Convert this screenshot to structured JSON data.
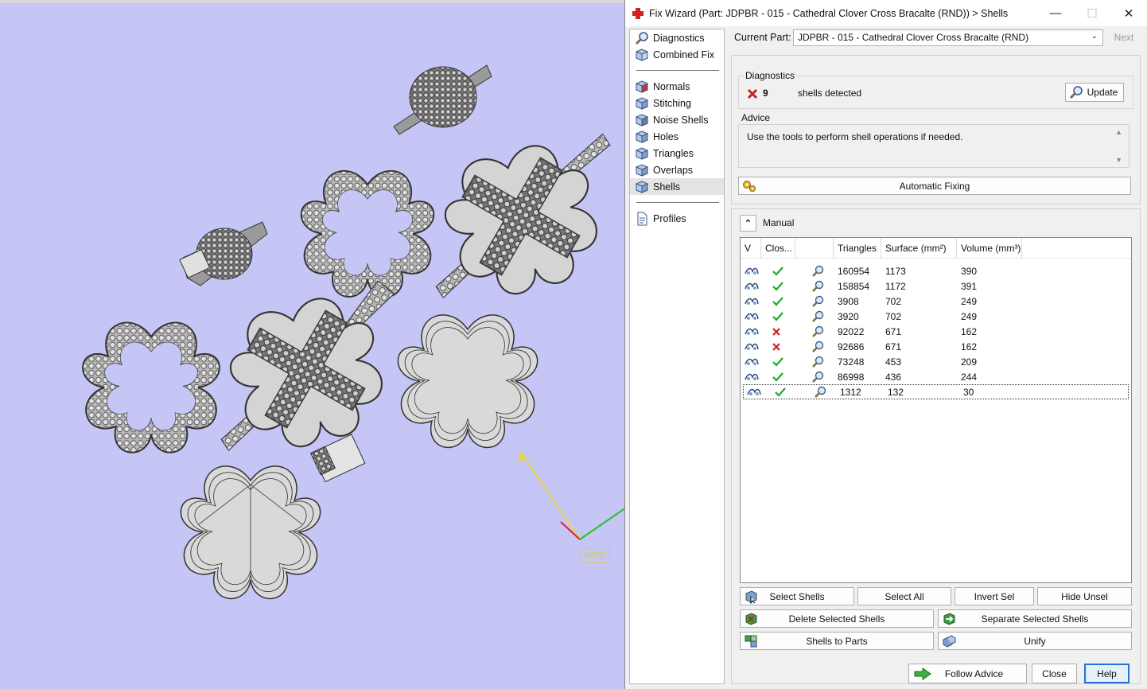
{
  "dialog": {
    "title": "Fix Wizard (Part: JDPBR - 015 -  Cathedral Clover Cross  Bracalte (RND)) > Shells"
  },
  "viewport": {
    "wcs_label": "WCS"
  },
  "nav": {
    "items_top": [
      {
        "label": "Diagnostics",
        "icon": "magnifier-icon"
      },
      {
        "label": "Combined Fix",
        "icon": "cube-icon"
      }
    ],
    "items_mid": [
      {
        "label": "Normals",
        "icon": "normals-cube-icon"
      },
      {
        "label": "Stitching",
        "icon": "stitching-cube-icon"
      },
      {
        "label": "Noise Shells",
        "icon": "noise-shells-icon"
      },
      {
        "label": "Holes",
        "icon": "holes-cube-icon"
      },
      {
        "label": "Triangles",
        "icon": "triangles-cube-icon"
      },
      {
        "label": "Overlaps",
        "icon": "overlaps-cube-icon"
      },
      {
        "label": "Shells",
        "icon": "shells-cube-icon"
      }
    ],
    "items_bottom": [
      {
        "label": "Profiles",
        "icon": "document-icon"
      }
    ],
    "selected": "Shells"
  },
  "current_part": {
    "label": "Current Part:",
    "value": "JDPBR - 015 -  Cathedral Clover Cross  Bracalte (RND)",
    "next_label": "Next"
  },
  "diagnostics": {
    "title": "Diagnostics",
    "count": "9",
    "text": "shells detected",
    "update_label": "Update"
  },
  "advice": {
    "title": "Advice",
    "text": "Use the tools to perform shell operations if needed.",
    "automatic_fixing_label": "Automatic Fixing"
  },
  "manual": {
    "title": "Manual",
    "columns": [
      "V",
      "Clos...",
      "",
      "Triangles",
      "Surface (mm²)",
      "Volume (mm³)"
    ],
    "rows": [
      {
        "closed": true,
        "triangles": "160954",
        "surface": "1173",
        "volume": "390"
      },
      {
        "closed": true,
        "triangles": "158854",
        "surface": "1172",
        "volume": "391"
      },
      {
        "closed": true,
        "triangles": "3908",
        "surface": "702",
        "volume": "249"
      },
      {
        "closed": true,
        "triangles": "3920",
        "surface": "702",
        "volume": "249"
      },
      {
        "closed": false,
        "triangles": "92022",
        "surface": "671",
        "volume": "162"
      },
      {
        "closed": false,
        "triangles": "92686",
        "surface": "671",
        "volume": "162"
      },
      {
        "closed": true,
        "triangles": "73248",
        "surface": "453",
        "volume": "209"
      },
      {
        "closed": true,
        "triangles": "86998",
        "surface": "436",
        "volume": "244"
      },
      {
        "closed": true,
        "triangles": "1312",
        "surface": "132",
        "volume": "30"
      }
    ],
    "selected_row": 8,
    "buttons": {
      "select_shells": "Select Shells",
      "select_all": "Select All",
      "invert_sel": "Invert Sel",
      "hide_unsel": "Hide Unsel",
      "delete_selected": "Delete Selected Shells",
      "separate_selected": "Separate Selected Shells",
      "shells_to_parts": "Shells to Parts",
      "unify": "Unify"
    }
  },
  "footer": {
    "follow_advice": "Follow Advice",
    "close": "Close",
    "help": "Help"
  },
  "colors": {
    "viewport_bg": "#c5c5f6",
    "check_green": "#1faa2c",
    "cross_red": "#cc2222",
    "help_border": "#2a6fd6"
  }
}
